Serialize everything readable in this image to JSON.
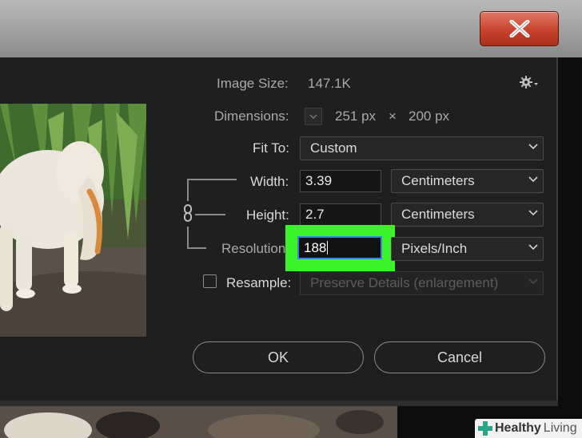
{
  "window": {
    "close_label": "X"
  },
  "image_size": {
    "label": "Image Size:",
    "value": "147.1K"
  },
  "dimensions": {
    "label": "Dimensions:",
    "width_value": "251 px",
    "times": "×",
    "height_value": "200 px"
  },
  "fit_to": {
    "label": "Fit To:",
    "value": "Custom"
  },
  "width": {
    "label": "Width:",
    "value": "3.39",
    "unit": "Centimeters"
  },
  "height": {
    "label": "Height:",
    "value": "2.7",
    "unit": "Centimeters"
  },
  "resolution": {
    "label": "Resolution",
    "value": "188",
    "unit": "Pixels/Inch"
  },
  "resample": {
    "label": "Resample:",
    "checked": false,
    "method": "Preserve Details (enlargement)"
  },
  "buttons": {
    "ok": "OK",
    "cancel": "Cancel"
  },
  "watermark": {
    "brand": "Healthy",
    "brand2": "Living"
  },
  "colors": {
    "highlight": "#3bf32b",
    "focus_border": "#3a86d6",
    "close_button": "#c8432c"
  }
}
